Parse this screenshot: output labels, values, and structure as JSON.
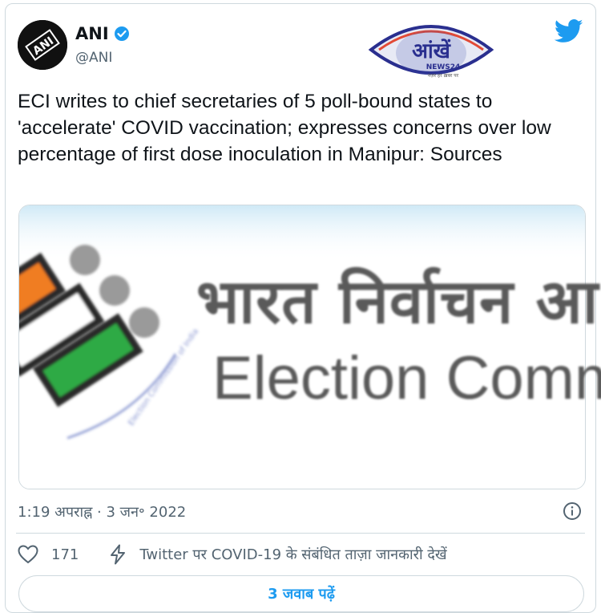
{
  "tweet": {
    "author_name": "ANI",
    "author_handle": "@ANI",
    "avatar_text": "ANI",
    "text": "ECI writes to chief secretaries of 5 poll-bound states to 'accelerate' COVID vaccination; expresses concerns over low percentage of first dose inoculation in Manipur: Sources",
    "timestamp": "1:19 अपराह्न · 3 जन॰ 2022",
    "like_count": "171",
    "cta_text": "Twitter पर COVID-19 के संबंधित ताज़ा जानकारी देखें",
    "replies_button": "3 जवाब पढ़ें"
  },
  "media": {
    "hindi_title": "भारत निर्वाचन आ",
    "english_title": "Election Comm",
    "logo_caption": "Election Commission of India"
  },
  "watermark": {
    "title": "आंखें",
    "subtitle": "NEWS24",
    "tagline": "नज़र हर ख़बर पर"
  },
  "colors": {
    "twitter_blue": "#1d9bf0",
    "verified_blue": "#1d9bf0",
    "orange": "#f07d20",
    "green": "#2eaa44",
    "grey_text": "#536471"
  },
  "icons": [
    "verified-badge-icon",
    "twitter-bird-icon",
    "info-icon",
    "heart-icon",
    "bolt-icon"
  ]
}
